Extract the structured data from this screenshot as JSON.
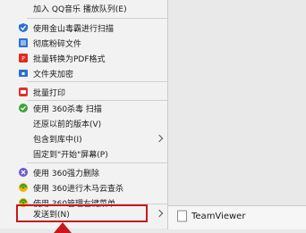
{
  "menu": {
    "items": [
      {
        "label": "加入 QQ音乐 播放队列(E)",
        "icon": "none"
      },
      {
        "label": "使用金山毒霸进行扫描",
        "icon": "shield-blue-icon"
      },
      {
        "label": "彻底粉碎文件",
        "icon": "shred-icon"
      },
      {
        "label": "批量转换为PDF格式",
        "icon": "pdf-icon"
      },
      {
        "label": "文件夹加密",
        "icon": "folder-lock-icon"
      },
      {
        "label": "批量打印",
        "icon": "print-icon"
      },
      {
        "label": "使用 360杀毒 扫描",
        "icon": "360-antivirus-icon"
      },
      {
        "label": "还原以前的版本(V)",
        "icon": "none"
      },
      {
        "label": "包含到库中(I)",
        "icon": "none"
      },
      {
        "label": "固定到\"开始\"屏幕(P)",
        "icon": "none"
      },
      {
        "label": "使用 360强力删除",
        "icon": "360-delete-icon"
      },
      {
        "label": "使用 360进行木马云查杀",
        "icon": "360-trojan-icon"
      },
      {
        "label": "使用 360管理右键菜单",
        "icon": "360-menu-icon"
      },
      {
        "label": "发送到(N)",
        "icon": "none"
      }
    ]
  },
  "submenu": {
    "items": [
      {
        "label": "TeamViewer",
        "icon": "file-icon"
      }
    ]
  },
  "colors": {
    "highlight": "#c7191c",
    "blue": "#2a6fd6",
    "green": "#3aa534"
  }
}
